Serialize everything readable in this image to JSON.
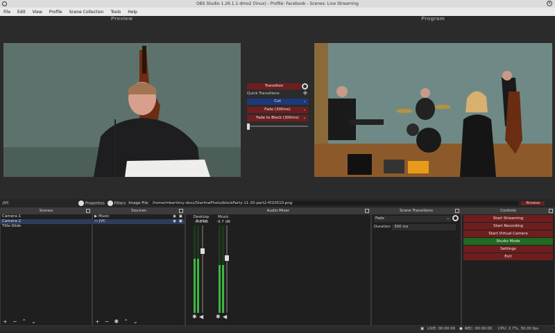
{
  "window": {
    "title": "OBS Studio 1.26.1.1-dmo2 (linux) - Profile: Facebook - Scenes: Live Streaming"
  },
  "menu": {
    "items": [
      "File",
      "Edit",
      "View",
      "Profile",
      "Scene Collection",
      "Tools",
      "Help"
    ]
  },
  "preview": {
    "title": "Preview"
  },
  "program": {
    "title": "Program"
  },
  "transitions": {
    "transition_label": "Transition",
    "quick_label": "Quick Transitions",
    "options": [
      "Cut",
      "Fade (300ms)",
      "Fade to Black (300ms)"
    ]
  },
  "infobar": {
    "source_name": "JVC",
    "properties_label": "Properties",
    "filters_label": "Filters",
    "image_file_label": "Image File",
    "path": "/home/mbertimy-docs/StarlinePhoto/blockParty-11-20-part2-f010510.png",
    "browse_label": "Browse"
  },
  "scenes": {
    "title": "Scenes",
    "items": [
      "Camera-1",
      "Camera-2",
      "Title-Slide"
    ]
  },
  "sources": {
    "title": "Sources",
    "items": [
      "Music",
      "JVC"
    ]
  },
  "mixer": {
    "title": "Audio Mixer",
    "channels": [
      {
        "name": "Desktop Audio",
        "db": "-6.3 dB",
        "level": 0.62,
        "fader": 0.74
      },
      {
        "name": "Music",
        "db": "-9.7 dB",
        "level": 0.55,
        "fader": 0.66
      }
    ]
  },
  "scene_transitions": {
    "title": "Scene Transitions",
    "selected": "Fade",
    "duration_label": "Duration",
    "duration_value": "300 ms"
  },
  "controls": {
    "title": "Controls",
    "start_streaming": "Start Streaming",
    "start_recording": "Start Recording",
    "start_virtual_camera": "Start Virtual Camera",
    "studio_mode": "Studio Mode",
    "settings": "Settings",
    "exit": "Exit"
  },
  "status": {
    "live": "LIVE: 00:00:00",
    "rec": "REC: 00:00:00",
    "cpu": "CPU: 2.7%, 30.00 fps"
  },
  "colors": {
    "accent_red": "#6e1e1e",
    "accent_green": "#1f6b1f",
    "selected_blue": "#1c3a7a"
  }
}
